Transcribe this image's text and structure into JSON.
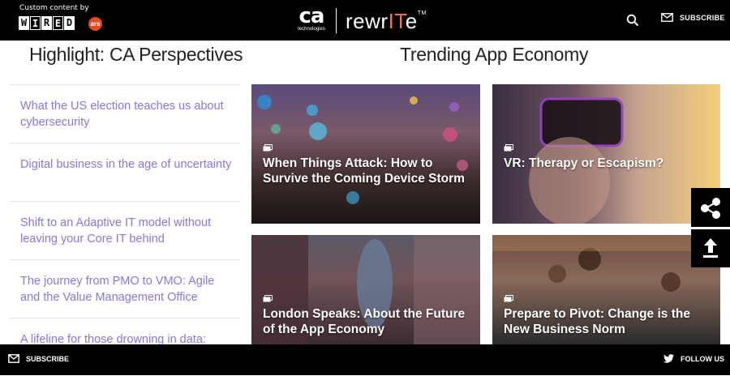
{
  "header": {
    "custom_content": "Custom content by",
    "wired_letters": [
      "W",
      "I",
      "R",
      "E",
      "D"
    ],
    "ars_label": "ars",
    "ca_label": "ca",
    "ca_tagline": "technologies",
    "rewrite_pre": "rewr",
    "rewrite_it": "IT",
    "rewrite_post": "e",
    "rewrite_tm": "TM",
    "subscribe_label": "SUBSCRIBE"
  },
  "sections": {
    "left_heading": "Highlight: CA Perspectives",
    "right_heading": "Trending App Economy"
  },
  "left_list": [
    "What the US election teaches us about cybersecurity",
    "Digital business in the age of uncertainty",
    "Shift to an Adaptive IT model without leaving your Core IT behind",
    "The journey from PMO to VMO: Agile and the Value Management Office",
    "A lifeline for those drowning in data:"
  ],
  "cards": [
    "When Things Attack: How to Survive the Coming Device Storm",
    "VR: Therapy or Escapism?",
    "London Speaks: About the Future of the App Economy",
    "Prepare to Pivot: Change is the New Business Norm"
  ],
  "footer": {
    "subscribe_label": "SUBSCRIBE",
    "follow_label": "FOLLOW US"
  },
  "colors": {
    "link": "#8b74ea",
    "bar": "#000000",
    "accent": "#ff6a4b"
  },
  "icons": [
    "search-icon",
    "mail-icon",
    "share-icon",
    "upload-icon",
    "twitter-icon",
    "gallery-icon"
  ]
}
